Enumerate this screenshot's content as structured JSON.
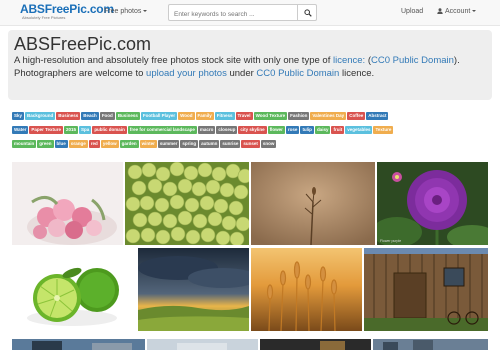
{
  "nav": {
    "logo": "ABSFreePic.com",
    "logo_sub": "Absolutely Free Pictures",
    "free_photos": "Free photos",
    "search_placeholder": "Enter keywords to search ...",
    "upload": "Upload",
    "account": "Account"
  },
  "jumbo": {
    "title": "ABSFreePic.com",
    "line1_a": "A high-resolution and absolutely free photos stock site with only one type of ",
    "line1_link": "licence:",
    "line1_b": " (",
    "line1_link2": "CC0 Public Domain",
    "line1_c": ").",
    "line2_a": "Photographers are welcome to ",
    "line2_link": "upload your photos",
    "line2_b": " under ",
    "line2_link2": "CC0 Public Domain",
    "line2_c": " licence."
  },
  "tags": {
    "row1": [
      {
        "label": "Sky",
        "color": "c-blue"
      },
      {
        "label": "Background",
        "color": "c-cyan"
      },
      {
        "label": "Business",
        "color": "c-red"
      },
      {
        "label": "Beach",
        "color": "c-blue"
      },
      {
        "label": "Food",
        "color": "c-gray"
      },
      {
        "label": "Business",
        "color": "c-green"
      },
      {
        "label": "Football Player",
        "color": "c-cyan"
      },
      {
        "label": "Wood",
        "color": "c-orange"
      },
      {
        "label": "Family",
        "color": "c-orange"
      },
      {
        "label": "Fitness",
        "color": "c-cyan"
      },
      {
        "label": "Travel",
        "color": "c-red"
      },
      {
        "label": "Wood Texture",
        "color": "c-green"
      },
      {
        "label": "Fashion",
        "color": "c-gray"
      },
      {
        "label": "Valentines Day",
        "color": "c-orange"
      },
      {
        "label": "Coffee",
        "color": "c-red"
      },
      {
        "label": "Abstract",
        "color": "c-blue"
      }
    ],
    "row2": [
      {
        "label": "Water",
        "color": "c-blue"
      },
      {
        "label": "Paper Texture",
        "color": "c-red"
      },
      {
        "label": "2015",
        "color": "c-green"
      },
      {
        "label": "Spa",
        "color": "c-cyan"
      },
      {
        "label": "public domain",
        "color": "c-red"
      },
      {
        "label": "free for commercial landscape",
        "color": "c-green"
      },
      {
        "label": "macro",
        "color": "c-gray"
      },
      {
        "label": "closeup",
        "color": "c-gray"
      },
      {
        "label": "city skyline",
        "color": "c-red"
      },
      {
        "label": "flower",
        "color": "c-green"
      },
      {
        "label": "rose",
        "color": "c-blue"
      },
      {
        "label": "tulip",
        "color": "c-blue"
      },
      {
        "label": "daisy",
        "color": "c-green"
      },
      {
        "label": "fruit",
        "color": "c-red"
      },
      {
        "label": "vegetables",
        "color": "c-cyan"
      },
      {
        "label": "Texture",
        "color": "c-orange"
      }
    ],
    "row3": [
      {
        "label": "mountain",
        "color": "c-green"
      },
      {
        "label": "green",
        "color": "c-green"
      },
      {
        "label": "blue",
        "color": "c-blue"
      },
      {
        "label": "orange",
        "color": "c-orange"
      },
      {
        "label": "red",
        "color": "c-red"
      },
      {
        "label": "yellow",
        "color": "c-orange"
      },
      {
        "label": "garden",
        "color": "c-green"
      },
      {
        "label": "winter",
        "color": "c-orange"
      },
      {
        "label": "summer",
        "color": "c-gray"
      },
      {
        "label": "spring",
        "color": "c-gray"
      },
      {
        "label": "autumn",
        "color": "c-gray"
      },
      {
        "label": "sunrise",
        "color": "c-gray"
      },
      {
        "label": "sunset",
        "color": "c-red"
      },
      {
        "label": "snow",
        "color": "c-gray"
      }
    ]
  },
  "photos": {
    "caption_flower": "Flower purple"
  }
}
